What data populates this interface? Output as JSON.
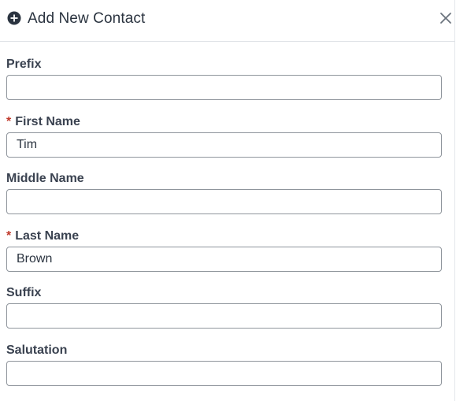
{
  "dialog": {
    "title": "Add New Contact",
    "header_icon": "plus-circle-icon",
    "close_icon": "close-icon"
  },
  "fields": {
    "prefix": {
      "label": "Prefix",
      "required": false,
      "value": "",
      "placeholder": ""
    },
    "first_name": {
      "label": "First Name",
      "required": true,
      "required_mark": "*",
      "value": "Tim",
      "placeholder": ""
    },
    "middle_name": {
      "label": "Middle Name",
      "required": false,
      "value": "",
      "placeholder": ""
    },
    "last_name": {
      "label": "Last Name",
      "required": true,
      "required_mark": "*",
      "value": "Brown",
      "placeholder": ""
    },
    "suffix": {
      "label": "Suffix",
      "required": false,
      "value": "",
      "placeholder": ""
    },
    "salutation": {
      "label": "Salutation",
      "required": false,
      "value": "",
      "placeholder": ""
    }
  },
  "colors": {
    "text": "#2b3440",
    "required_mark": "#c0392b",
    "input_border": "#8f959c",
    "divider": "#dfe2e6"
  }
}
